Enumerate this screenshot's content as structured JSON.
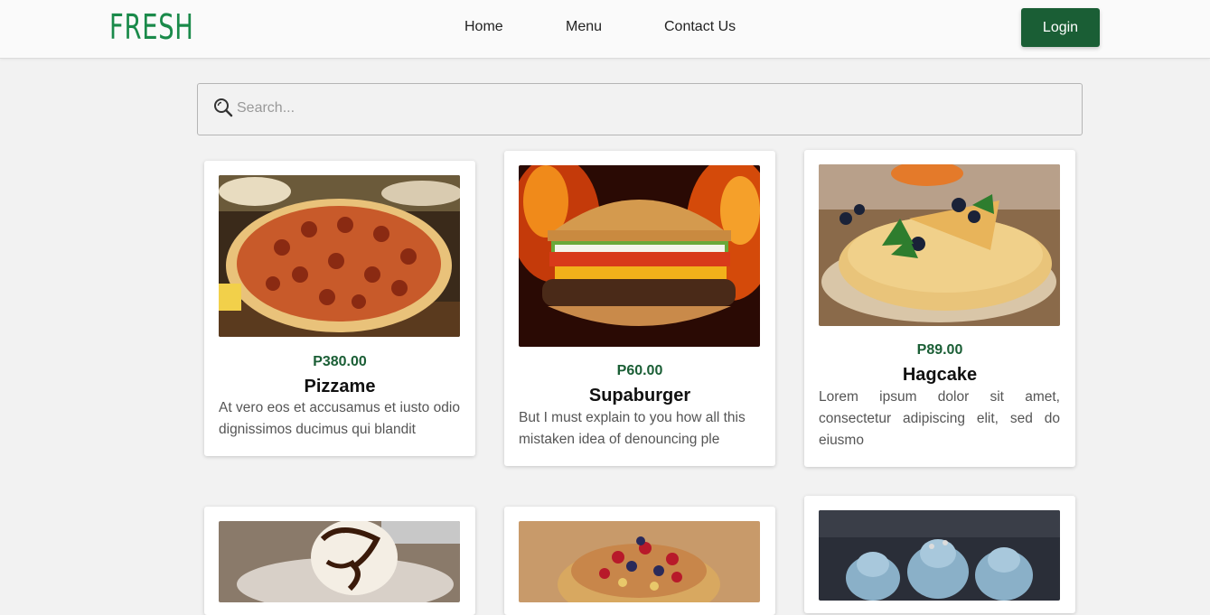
{
  "brand": {
    "logo_text": "FRESH",
    "logo_color": "#1a8a4a",
    "accent_color": "#1a5e35"
  },
  "nav": {
    "links": [
      {
        "label": "Home"
      },
      {
        "label": "Menu"
      },
      {
        "label": "Contact Us"
      }
    ],
    "login_label": "Login"
  },
  "search": {
    "placeholder": "Search...",
    "value": "",
    "icon": "search-icon"
  },
  "products": [
    {
      "price": "P380.00",
      "name": "Pizzame",
      "description": "At vero eos et accusamus et iusto odio dignissimos ducimus qui blandit",
      "image": "pizza-image"
    },
    {
      "price": "P60.00",
      "name": "Supaburger",
      "description": "But I must explain to you how all this mistaken idea of denouncing ple",
      "image": "burger-image"
    },
    {
      "price": "P89.00",
      "name": "Hagcake",
      "description": "Lorem ipsum dolor sit amet, consectetur adipiscing elit, sed do eiusmo",
      "image": "crepe-image"
    },
    {
      "image": "ice-cream-image"
    },
    {
      "image": "fruit-tart-image"
    },
    {
      "image": "cupcakes-image"
    }
  ]
}
